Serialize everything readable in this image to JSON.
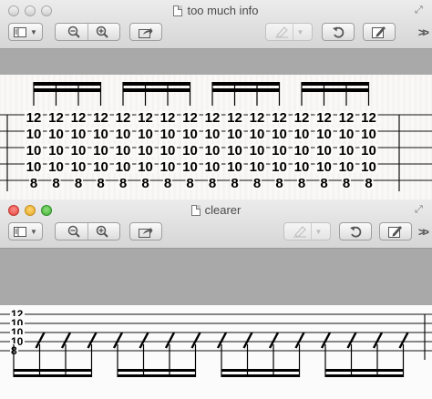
{
  "window1": {
    "title": "too much info",
    "toolbar": [
      "sidebar-icon",
      "zoom-out-icon",
      "zoom-in-icon",
      "share-icon",
      "highlight-icon",
      "rotate-icon",
      "annotate-icon"
    ],
    "chevron": ">>"
  },
  "window2": {
    "title": "clearer",
    "toolbar": [
      "sidebar-icon",
      "zoom-out-icon",
      "zoom-in-icon",
      "share-icon",
      "highlight-icon",
      "rotate-icon",
      "annotate-icon"
    ],
    "chevron": ">>"
  },
  "tab1": {
    "strings": [
      "12",
      "10",
      "10",
      "10",
      "8"
    ],
    "note_count": 16
  },
  "tab2": {
    "strings": [
      "12",
      "10",
      "10",
      "10",
      "8"
    ]
  }
}
